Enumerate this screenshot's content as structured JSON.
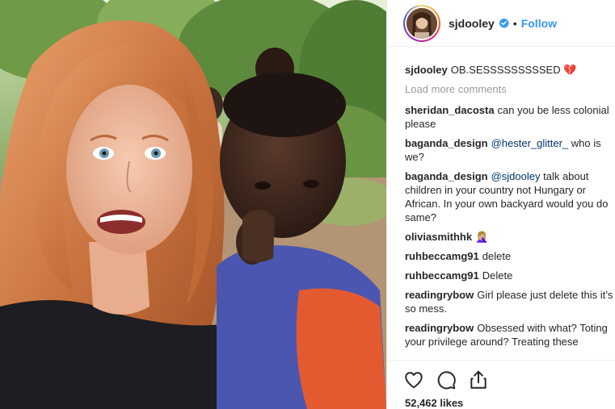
{
  "post": {
    "photo_icon": "photo-selfie-woman-and-child"
  },
  "header": {
    "username": "sjdooley",
    "separator": "•",
    "follow_label": "Follow",
    "verified_icon": "verified-badge-icon",
    "accent_color": "#3897f0"
  },
  "caption": {
    "user": "sjdooley",
    "text": "OB.SESSSSSSSSSED 💔"
  },
  "load_more_label": "Load more comments",
  "comments": [
    {
      "user": "sheridan_dacosta",
      "mention": "",
      "text": "can you be less colonial please"
    },
    {
      "user": "baganda_design",
      "mention": "@hester_glitter_",
      "text": " who is we?"
    },
    {
      "user": "baganda_design",
      "mention": "@sjdooley",
      "text": " talk about children in your country not Hungary or African. In your own backyard would you do same?"
    },
    {
      "user": "oliviasmithhk",
      "mention": "",
      "text": "🤦🏼‍♀️"
    },
    {
      "user": "ruhbeccamg91",
      "mention": "",
      "text": "delete"
    },
    {
      "user": "ruhbeccamg91",
      "mention": "",
      "text": "Delete"
    },
    {
      "user": "readingrybow",
      "mention": "",
      "text": "Girl please just delete this it’s so mess."
    },
    {
      "user": "readingrybow",
      "mention": "",
      "text": "Obsessed with what? Toting your privilege around? Treating these"
    }
  ],
  "actions": {
    "like_icon": "heart-icon",
    "comment_icon": "comment-bubble-icon",
    "share_icon": "share-icon"
  },
  "likes_label": "52,462 likes"
}
